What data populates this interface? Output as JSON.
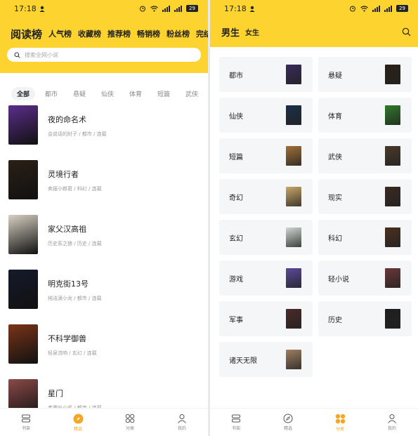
{
  "status": {
    "time": "17:18",
    "battery": "29"
  },
  "left": {
    "rank_tabs": [
      "阅读榜",
      "人气榜",
      "收藏榜",
      "推荐榜",
      "畅销榜",
      "粉丝榜",
      "完结"
    ],
    "search_placeholder": "搜索全网小说",
    "categories": [
      "全部",
      "都市",
      "悬疑",
      "仙侠",
      "体育",
      "短篇",
      "武侠"
    ],
    "books": [
      {
        "title": "夜的命名术",
        "meta": "会说话的肘子 / 都市 / 连载",
        "cover_color": "#5b2d8a"
      },
      {
        "title": "灵境行者",
        "meta": "卖报小郎君 / 科幻 / 连载",
        "cover_color": "#2a2016"
      },
      {
        "title": "家父汉高祖",
        "meta": "历史系之狼 / 历史 / 连载",
        "cover_color": "#d8d0c2"
      },
      {
        "title": "明克街13号",
        "meta": "纯洁滴小龙 / 都市 / 连载",
        "cover_color": "#151a2b"
      },
      {
        "title": "不科学御兽",
        "meta": "轻泉流响 / 玄幻 / 连载",
        "cover_color": "#7a3418"
      },
      {
        "title": "星门",
        "meta": "老鹰吃小鸡 / 都市 / 连载",
        "cover_color": "#8a4a48"
      }
    ],
    "nav": [
      "书架",
      "精选",
      "分类",
      "我的"
    ]
  },
  "right": {
    "gender_tabs": [
      "男生",
      "女生"
    ],
    "categories": [
      {
        "name": "都市",
        "color": "#3a2a5a"
      },
      {
        "name": "悬疑",
        "color": "#2a2016"
      },
      {
        "name": "仙侠",
        "color": "#1a3048"
      },
      {
        "name": "体育",
        "color": "#2f7a2a"
      },
      {
        "name": "短篇",
        "color": "#a07038"
      },
      {
        "name": "武侠",
        "color": "#4a3a2a"
      },
      {
        "name": "奇幻",
        "color": "#c9a868"
      },
      {
        "name": "现实",
        "color": "#3a2a22"
      },
      {
        "name": "玄幻",
        "color": "#cfd8d0"
      },
      {
        "name": "科幻",
        "color": "#4a3020"
      },
      {
        "name": "游戏",
        "color": "#5a4a9a"
      },
      {
        "name": "轻小说",
        "color": "#6a3838"
      },
      {
        "name": "军事",
        "color": "#4a2a28"
      },
      {
        "name": "历史",
        "color": "#1e1e1e"
      },
      {
        "name": "诸天无限",
        "color": "#a08060"
      }
    ],
    "nav": [
      "书架",
      "精选",
      "分类",
      "我的"
    ]
  },
  "colors": {
    "accent": "#fdd42f",
    "nav_active": "#f5a623"
  }
}
